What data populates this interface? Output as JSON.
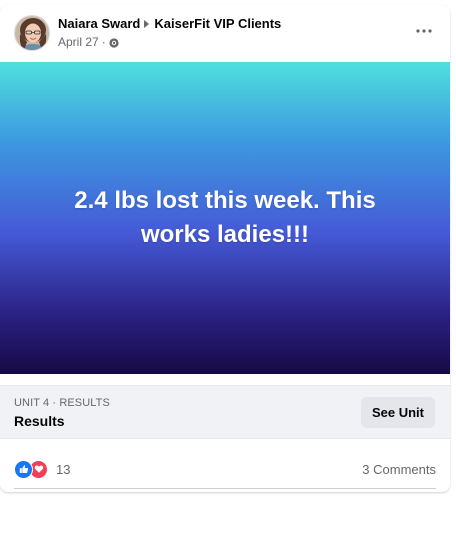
{
  "post": {
    "author": "Naiara Sward",
    "group": "KaiserFit VIP Clients",
    "date": "April 27",
    "date_separator": "·",
    "more_icon": "ellipsis-icon",
    "privacy_icon": "globe-icon",
    "image_text": "2.4 lbs lost this week. This works ladies!!!",
    "gradient_colors": [
      "#4fe0dd",
      "#3d9ae0",
      "#4559d6",
      "#2a1f80",
      "#160a45"
    ]
  },
  "unit": {
    "label": "UNIT 4 · RESULTS",
    "title": "Results",
    "button_label": "See Unit"
  },
  "engagement": {
    "reaction_icons": [
      "like-icon",
      "love-icon"
    ],
    "reaction_count": "13",
    "comments_label": "3 Comments"
  },
  "colors": {
    "like": "#1877f2",
    "love": "#f33e58",
    "secondary_text": "#65676b"
  }
}
